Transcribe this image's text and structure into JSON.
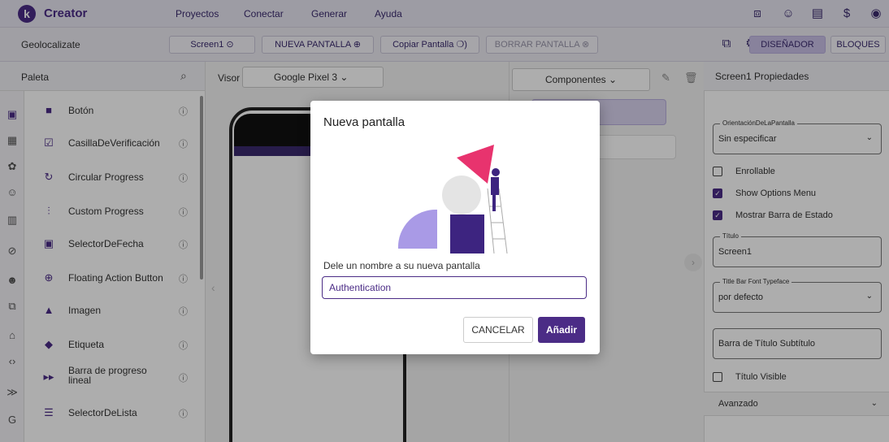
{
  "app": {
    "name": "Creator",
    "logo_letter": "k"
  },
  "topmenu": [
    "Proyectos",
    "Conectar",
    "Generar",
    "Ayuda"
  ],
  "project": {
    "name": "Geolocalizate"
  },
  "toolbar": {
    "screen_select": "Screen1",
    "new_screen": "NUEVA PANTALLA ⊕",
    "copy_screen": "Copiar Pantalla ❍)",
    "delete_screen": "BORRAR PANTALLA ⊗",
    "designer": "DISEÑADOR",
    "blocks": "BLOQUES"
  },
  "palette": {
    "title": "Paleta",
    "items": [
      {
        "label": "Botón",
        "icon": "button-icon"
      },
      {
        "label": "CasillaDeVerificación",
        "icon": "checkbox-icon"
      },
      {
        "label": "Circular Progress",
        "icon": "circular-progress-icon"
      },
      {
        "label": "Custom Progress",
        "icon": "custom-progress-icon"
      },
      {
        "label": "SelectorDeFecha",
        "icon": "date-picker-icon"
      },
      {
        "label": "Floating Action Button",
        "icon": "fab-icon"
      },
      {
        "label": "Imagen",
        "icon": "image-icon"
      },
      {
        "label": "Etiqueta",
        "icon": "label-icon"
      },
      {
        "label": "Barra de progreso lineal",
        "icon": "linear-progress-icon"
      },
      {
        "label": "SelectorDeLista",
        "icon": "list-picker-icon"
      }
    ]
  },
  "viewer": {
    "label": "Visor",
    "device": "Google Pixel 3"
  },
  "components": {
    "select": "Componentes"
  },
  "properties": {
    "title": "Screen1 Propiedades",
    "orientation_label": "OrientaciónDeLaPantalla",
    "orientation_value": "Sin especificar",
    "scrollable": "Enrollable",
    "show_options": "Show Options Menu",
    "show_status": "Mostrar Barra de Estado",
    "title_label": "Título",
    "title_value": "Screen1",
    "font_label": "Title Bar Font Typeface",
    "font_value": "por defecto",
    "subtitle_placeholder": "Barra de Título Subtítulo",
    "title_visible": "Título Visible",
    "advanced": "Avanzado"
  },
  "dialog": {
    "title": "Nueva pantalla",
    "prompt": "Dele un nombre a su nueva pantalla",
    "input_value": "Authentication",
    "cancel": "CANCELAR",
    "add": "Añadir"
  },
  "colors": {
    "accent": "#4b2c86",
    "illustration_pink": "#e8336e",
    "illustration_lilac": "#a99ae6"
  }
}
